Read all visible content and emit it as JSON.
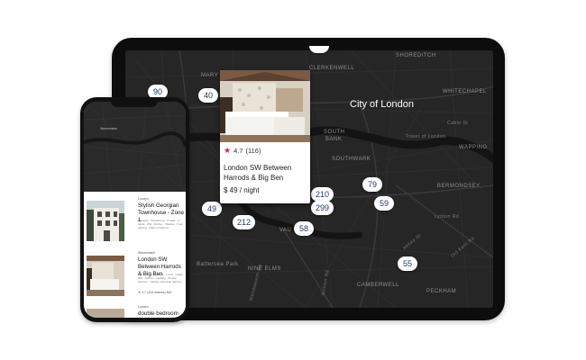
{
  "tablet_map": {
    "city_label": "City of London",
    "area_labels": {
      "clerkenwell": "CLERKENWELL",
      "shoreditch": "SHOREDITCH",
      "whitechapel": "WHITECHAPEL",
      "south_bank": "SOUTH\nBANK",
      "southwark": "SOUTHWARK",
      "tower_of_london": "Tower of London",
      "wapping": "WAPPING",
      "bermondsey": "BERMONDSEY",
      "nine_elms": "NINE ELMS",
      "battersea_park": "Battersea Park",
      "camberwell": "CAMBERWELL",
      "peckham": "PECKHAM",
      "mary": "MARY",
      "vau": "VAU",
      "cable_st": "Cable St",
      "lynton_rd": "Lynton Rd",
      "abbey_st": "Abbey St",
      "old_kent_rd": "Old Kent Rd",
      "brixton_rd": "Brixton Rd",
      "wandsworth_rd": "Wandsworth Rd"
    },
    "price_pins": [
      "90",
      "40",
      "210",
      "299",
      "79",
      "59",
      "49",
      "212",
      "58",
      "55"
    ],
    "popup": {
      "rating": "4.7",
      "reviews": "(116)",
      "title": "London SW Between Harrods & Big Ben",
      "price": "$ 49 / night"
    }
  },
  "phone": {
    "map_label": "Westminster",
    "listings": [
      {
        "area": "London",
        "title": "Stylish Georgian Townhouse - Zone 1",
        "meta": "8 guests · 3 bedrooms · 5 beds · 2 baths · Wifi · Kitchen · Washer · Free parking · Patio or balcony",
        "reviews": ""
      },
      {
        "area": "Westminster",
        "title": "London SW Between Harrods & Big Ben",
        "meta": "2 guests · 1 bedroom · 1 bed · 1 bath · Wifi · Kitchen · Heating · Smoke detector · Carbon monoxide detector",
        "reviews": "★ 4.7 (116 reviews)   $49"
      },
      {
        "area": "London",
        "title": "double bedroom",
        "meta": "",
        "reviews": ""
      }
    ]
  },
  "colors": {
    "map_bg": "#262626",
    "pin_text": "#1f3a6b",
    "star": "#e0242c"
  }
}
